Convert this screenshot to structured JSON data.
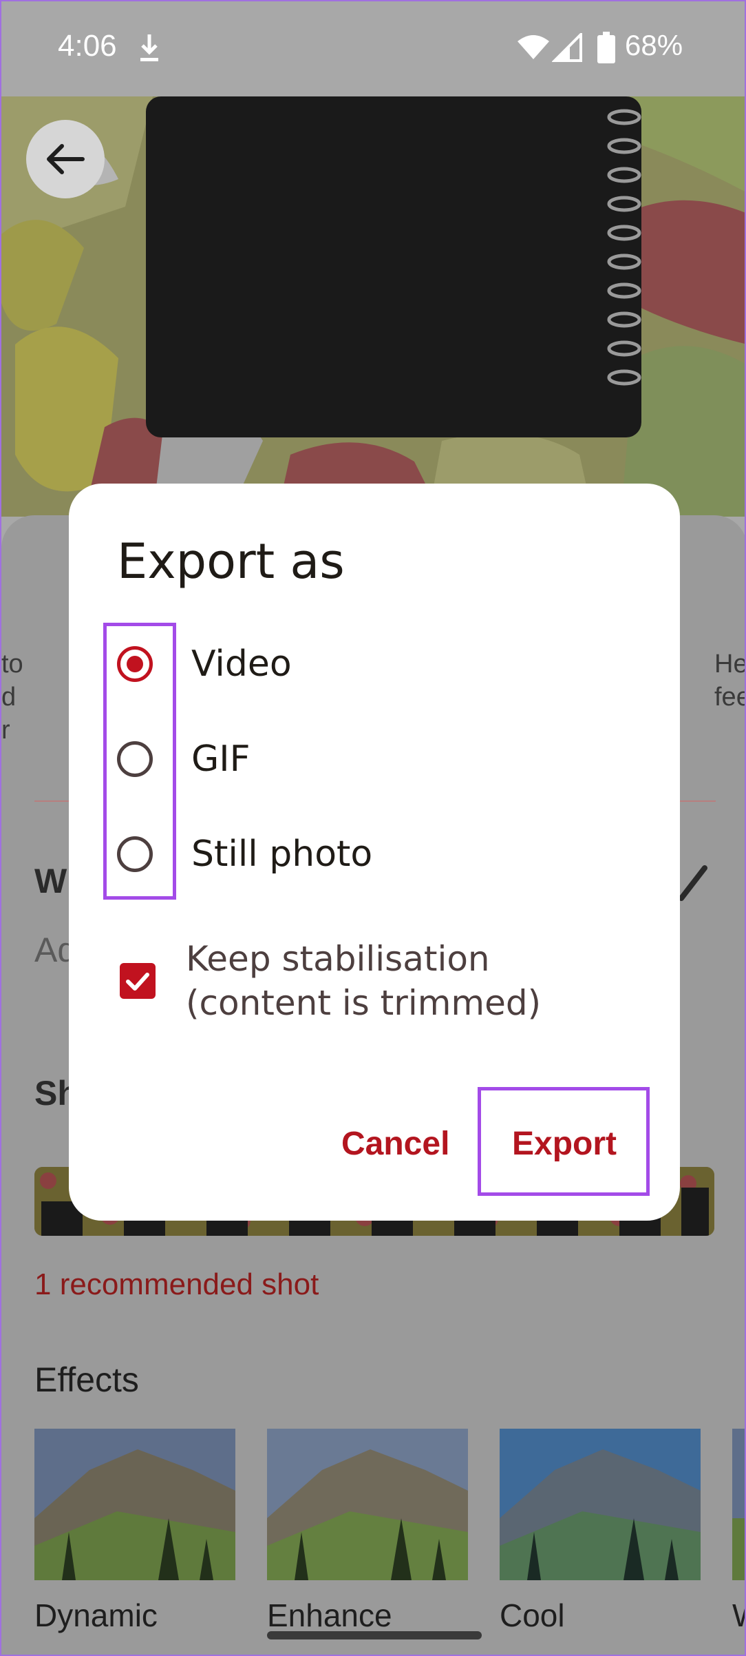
{
  "status_bar": {
    "time": "4:06",
    "battery": "68%"
  },
  "dialog": {
    "title": "Export as",
    "options": [
      {
        "label": "Video",
        "selected": true
      },
      {
        "label": "GIF",
        "selected": false
      },
      {
        "label": "Still photo",
        "selected": false
      }
    ],
    "stabilisation": {
      "label": "Keep stabilisation (content is trimmed)",
      "checked": true
    },
    "cancel_label": "Cancel",
    "export_label": "Export"
  },
  "background": {
    "left_fragment": [
      "to",
      "d",
      "r"
    ],
    "right_fragment": [
      "He",
      "fee"
    ],
    "title_fragment": "W",
    "subtitle_fragment": "Ad",
    "shots_fragment": "Sh",
    "recommended": "1 recommended shot",
    "effects_heading": "Effects",
    "effects": [
      {
        "label": "Dynamic"
      },
      {
        "label": "Enhance"
      },
      {
        "label": "Cool"
      },
      {
        "label": "W"
      }
    ]
  },
  "colors": {
    "accent": "#c1121f",
    "highlight": "#a34be8",
    "scrim": "#a8a8a8"
  }
}
